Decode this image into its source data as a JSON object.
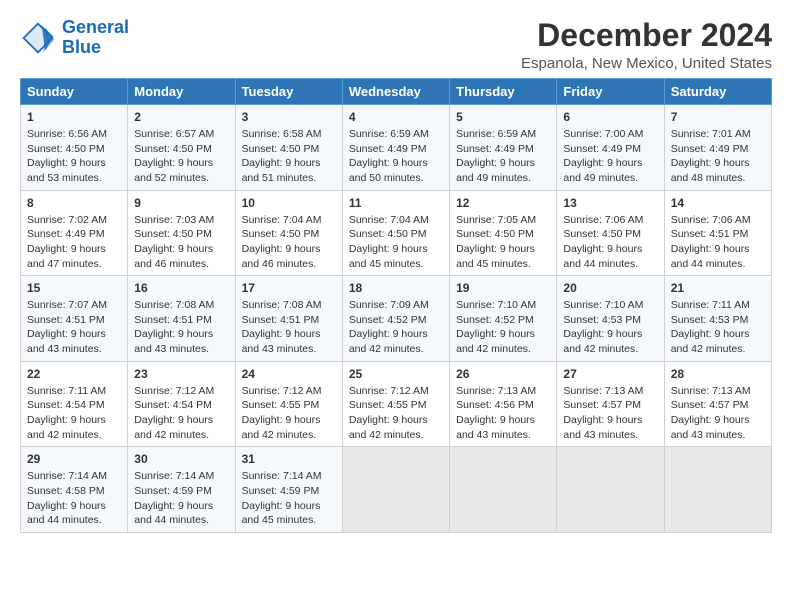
{
  "logo": {
    "line1": "General",
    "line2": "Blue"
  },
  "title": "December 2024",
  "subtitle": "Espanola, New Mexico, United States",
  "days_of_week": [
    "Sunday",
    "Monday",
    "Tuesday",
    "Wednesday",
    "Thursday",
    "Friday",
    "Saturday"
  ],
  "weeks": [
    [
      {
        "day": "1",
        "sunrise": "6:56 AM",
        "sunset": "4:50 PM",
        "daylight": "9 hours and 53 minutes."
      },
      {
        "day": "2",
        "sunrise": "6:57 AM",
        "sunset": "4:50 PM",
        "daylight": "9 hours and 52 minutes."
      },
      {
        "day": "3",
        "sunrise": "6:58 AM",
        "sunset": "4:50 PM",
        "daylight": "9 hours and 51 minutes."
      },
      {
        "day": "4",
        "sunrise": "6:59 AM",
        "sunset": "4:49 PM",
        "daylight": "9 hours and 50 minutes."
      },
      {
        "day": "5",
        "sunrise": "6:59 AM",
        "sunset": "4:49 PM",
        "daylight": "9 hours and 49 minutes."
      },
      {
        "day": "6",
        "sunrise": "7:00 AM",
        "sunset": "4:49 PM",
        "daylight": "9 hours and 49 minutes."
      },
      {
        "day": "7",
        "sunrise": "7:01 AM",
        "sunset": "4:49 PM",
        "daylight": "9 hours and 48 minutes."
      }
    ],
    [
      {
        "day": "8",
        "sunrise": "7:02 AM",
        "sunset": "4:49 PM",
        "daylight": "9 hours and 47 minutes."
      },
      {
        "day": "9",
        "sunrise": "7:03 AM",
        "sunset": "4:50 PM",
        "daylight": "9 hours and 46 minutes."
      },
      {
        "day": "10",
        "sunrise": "7:04 AM",
        "sunset": "4:50 PM",
        "daylight": "9 hours and 46 minutes."
      },
      {
        "day": "11",
        "sunrise": "7:04 AM",
        "sunset": "4:50 PM",
        "daylight": "9 hours and 45 minutes."
      },
      {
        "day": "12",
        "sunrise": "7:05 AM",
        "sunset": "4:50 PM",
        "daylight": "9 hours and 45 minutes."
      },
      {
        "day": "13",
        "sunrise": "7:06 AM",
        "sunset": "4:50 PM",
        "daylight": "9 hours and 44 minutes."
      },
      {
        "day": "14",
        "sunrise": "7:06 AM",
        "sunset": "4:51 PM",
        "daylight": "9 hours and 44 minutes."
      }
    ],
    [
      {
        "day": "15",
        "sunrise": "7:07 AM",
        "sunset": "4:51 PM",
        "daylight": "9 hours and 43 minutes."
      },
      {
        "day": "16",
        "sunrise": "7:08 AM",
        "sunset": "4:51 PM",
        "daylight": "9 hours and 43 minutes."
      },
      {
        "day": "17",
        "sunrise": "7:08 AM",
        "sunset": "4:51 PM",
        "daylight": "9 hours and 43 minutes."
      },
      {
        "day": "18",
        "sunrise": "7:09 AM",
        "sunset": "4:52 PM",
        "daylight": "9 hours and 42 minutes."
      },
      {
        "day": "19",
        "sunrise": "7:10 AM",
        "sunset": "4:52 PM",
        "daylight": "9 hours and 42 minutes."
      },
      {
        "day": "20",
        "sunrise": "7:10 AM",
        "sunset": "4:53 PM",
        "daylight": "9 hours and 42 minutes."
      },
      {
        "day": "21",
        "sunrise": "7:11 AM",
        "sunset": "4:53 PM",
        "daylight": "9 hours and 42 minutes."
      }
    ],
    [
      {
        "day": "22",
        "sunrise": "7:11 AM",
        "sunset": "4:54 PM",
        "daylight": "9 hours and 42 minutes."
      },
      {
        "day": "23",
        "sunrise": "7:12 AM",
        "sunset": "4:54 PM",
        "daylight": "9 hours and 42 minutes."
      },
      {
        "day": "24",
        "sunrise": "7:12 AM",
        "sunset": "4:55 PM",
        "daylight": "9 hours and 42 minutes."
      },
      {
        "day": "25",
        "sunrise": "7:12 AM",
        "sunset": "4:55 PM",
        "daylight": "9 hours and 42 minutes."
      },
      {
        "day": "26",
        "sunrise": "7:13 AM",
        "sunset": "4:56 PM",
        "daylight": "9 hours and 43 minutes."
      },
      {
        "day": "27",
        "sunrise": "7:13 AM",
        "sunset": "4:57 PM",
        "daylight": "9 hours and 43 minutes."
      },
      {
        "day": "28",
        "sunrise": "7:13 AM",
        "sunset": "4:57 PM",
        "daylight": "9 hours and 43 minutes."
      }
    ],
    [
      {
        "day": "29",
        "sunrise": "7:14 AM",
        "sunset": "4:58 PM",
        "daylight": "9 hours and 44 minutes."
      },
      {
        "day": "30",
        "sunrise": "7:14 AM",
        "sunset": "4:59 PM",
        "daylight": "9 hours and 44 minutes."
      },
      {
        "day": "31",
        "sunrise": "7:14 AM",
        "sunset": "4:59 PM",
        "daylight": "9 hours and 45 minutes."
      },
      null,
      null,
      null,
      null
    ]
  ],
  "labels": {
    "sunrise": "Sunrise:",
    "sunset": "Sunset:",
    "daylight": "Daylight:"
  }
}
